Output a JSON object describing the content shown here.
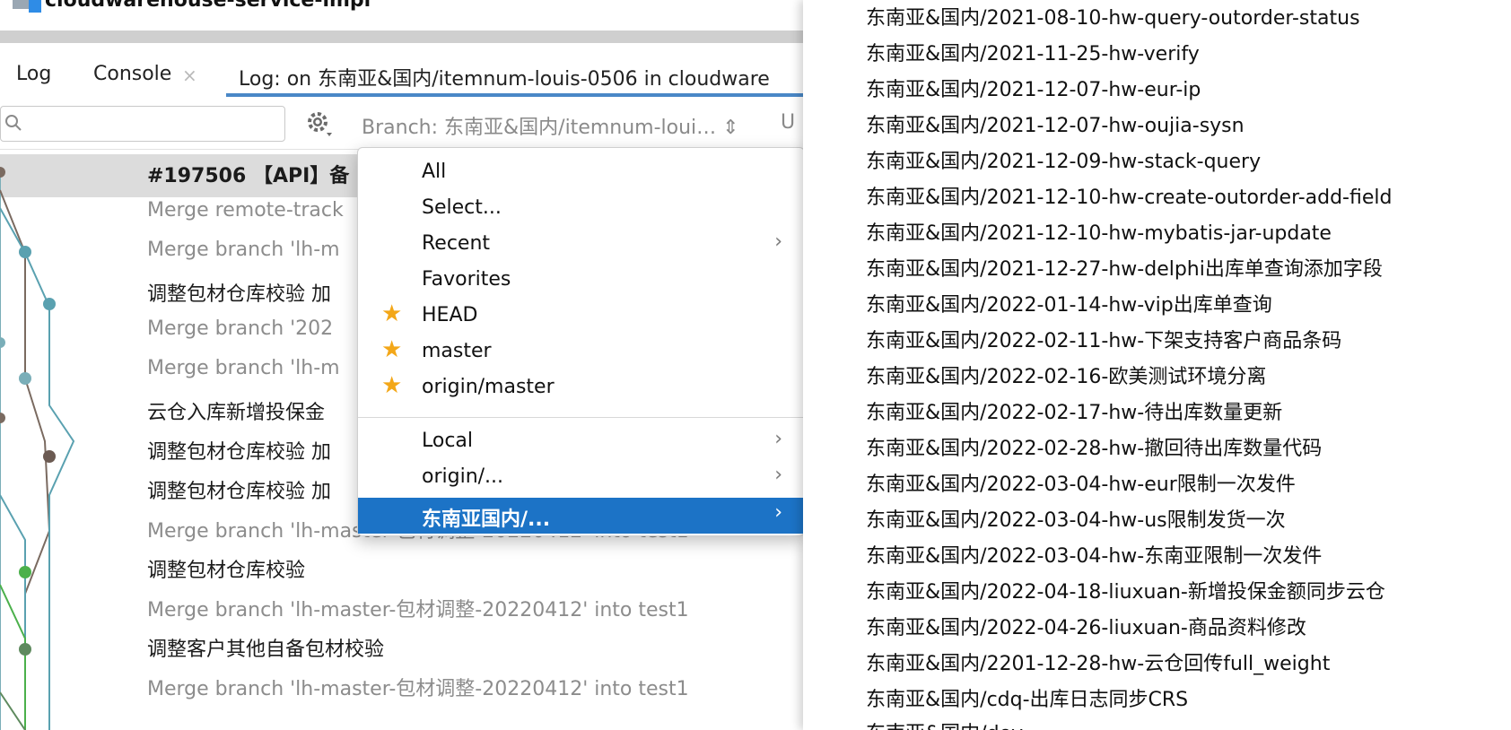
{
  "window": {
    "title": "cloudwarehouse-service-impl",
    "subtitle": "_"
  },
  "tabs": [
    {
      "label": "Log"
    },
    {
      "label": "Console",
      "close": "×"
    },
    {
      "label": "Log: on 东南亚&国内/itemnum-louis-0506 in cloudware"
    }
  ],
  "toolbar": {
    "search_placeholder": "",
    "branch_filter": "Branch: 东南亚&国内/itemnum-loui… ⇕",
    "user_filter": "U"
  },
  "log_rows": [
    {
      "text": "#197506 【API】备",
      "style": "bold"
    },
    {
      "text": "Merge remote-track",
      "style": "merge"
    },
    {
      "text": "Merge branch 'lh-m",
      "style": "merge"
    },
    {
      "text": "调整包材仓库校验 加",
      "style": "normal"
    },
    {
      "text": "Merge branch '202",
      "style": "merge"
    },
    {
      "text": "Merge branch 'lh-m",
      "style": "merge"
    },
    {
      "text": "云仓入库新增投保金",
      "style": "normal"
    },
    {
      "text": "调整包材仓库校验 加",
      "style": "normal"
    },
    {
      "text": "调整包材仓库校验 加",
      "style": "normal"
    },
    {
      "text": "Merge branch 'lh-master-包材调整-20220412' into test1",
      "style": "merge"
    },
    {
      "text": "调整包材仓库校验",
      "style": "normal"
    },
    {
      "text": "Merge branch 'lh-master-包材调整-20220412' into test1",
      "style": "merge"
    },
    {
      "text": "调整客户其他自备包材校验",
      "style": "normal"
    },
    {
      "text": "Merge branch 'lh-master-包材调整-20220412' into test1",
      "style": "merge"
    }
  ],
  "menu": {
    "items": [
      {
        "label": "All",
        "star": false,
        "submenu": false
      },
      {
        "label": "Select...",
        "star": false,
        "submenu": false
      },
      {
        "label": "Recent",
        "star": false,
        "submenu": true
      },
      {
        "label": "Favorites",
        "star": false,
        "submenu": false
      },
      {
        "label": "HEAD",
        "star": true,
        "submenu": false
      },
      {
        "label": "master",
        "star": true,
        "submenu": false
      },
      {
        "label": "origin/master",
        "star": true,
        "submenu": false
      },
      {
        "label": "Local",
        "star": false,
        "submenu": true
      },
      {
        "label": "origin/...",
        "star": false,
        "submenu": true
      },
      {
        "label": "东南亚国内/...",
        "star": false,
        "submenu": true,
        "highlighted": true
      }
    ],
    "star_glyph": "★",
    "chevron_glyph": "›",
    "highlight_color": "#1c73c6"
  },
  "branches": [
    "东南亚&国内/2021-08-10-hw-query-outorder-status",
    "东南亚&国内/2021-11-25-hw-verify",
    "东南亚&国内/2021-12-07-hw-eur-ip",
    "东南亚&国内/2021-12-07-hw-oujia-sysn",
    "东南亚&国内/2021-12-09-hw-stack-query",
    "东南亚&国内/2021-12-10-hw-create-outorder-add-field",
    "东南亚&国内/2021-12-10-hw-mybatis-jar-update",
    "东南亚&国内/2021-12-27-hw-delphi出库单查询添加字段",
    "东南亚&国内/2022-01-14-hw-vip出库单查询",
    "东南亚&国内/2022-02-11-hw-下架支持客户商品条码",
    "东南亚&国内/2022-02-16-欧美测试环境分离",
    "东南亚&国内/2022-02-17-hw-待出库数量更新",
    "东南亚&国内/2022-02-28-hw-撤回待出库数量代码",
    "东南亚&国内/2022-03-04-hw-eur限制一次发件",
    "东南亚&国内/2022-03-04-hw-us限制发货一次",
    "东南亚&国内/2022-03-04-hw-东南亚限制一次发件",
    "东南亚&国内/2022-04-18-liuxuan-新增投保金额同步云仓",
    "东南亚&国内/2022-04-26-liuxuan-商品资料修改",
    "东南亚&国内/2201-12-28-hw-云仓回传full_weight",
    "东南亚&国内/cdq-出库日志同步CRS",
    "东南亚&国内/dev"
  ]
}
